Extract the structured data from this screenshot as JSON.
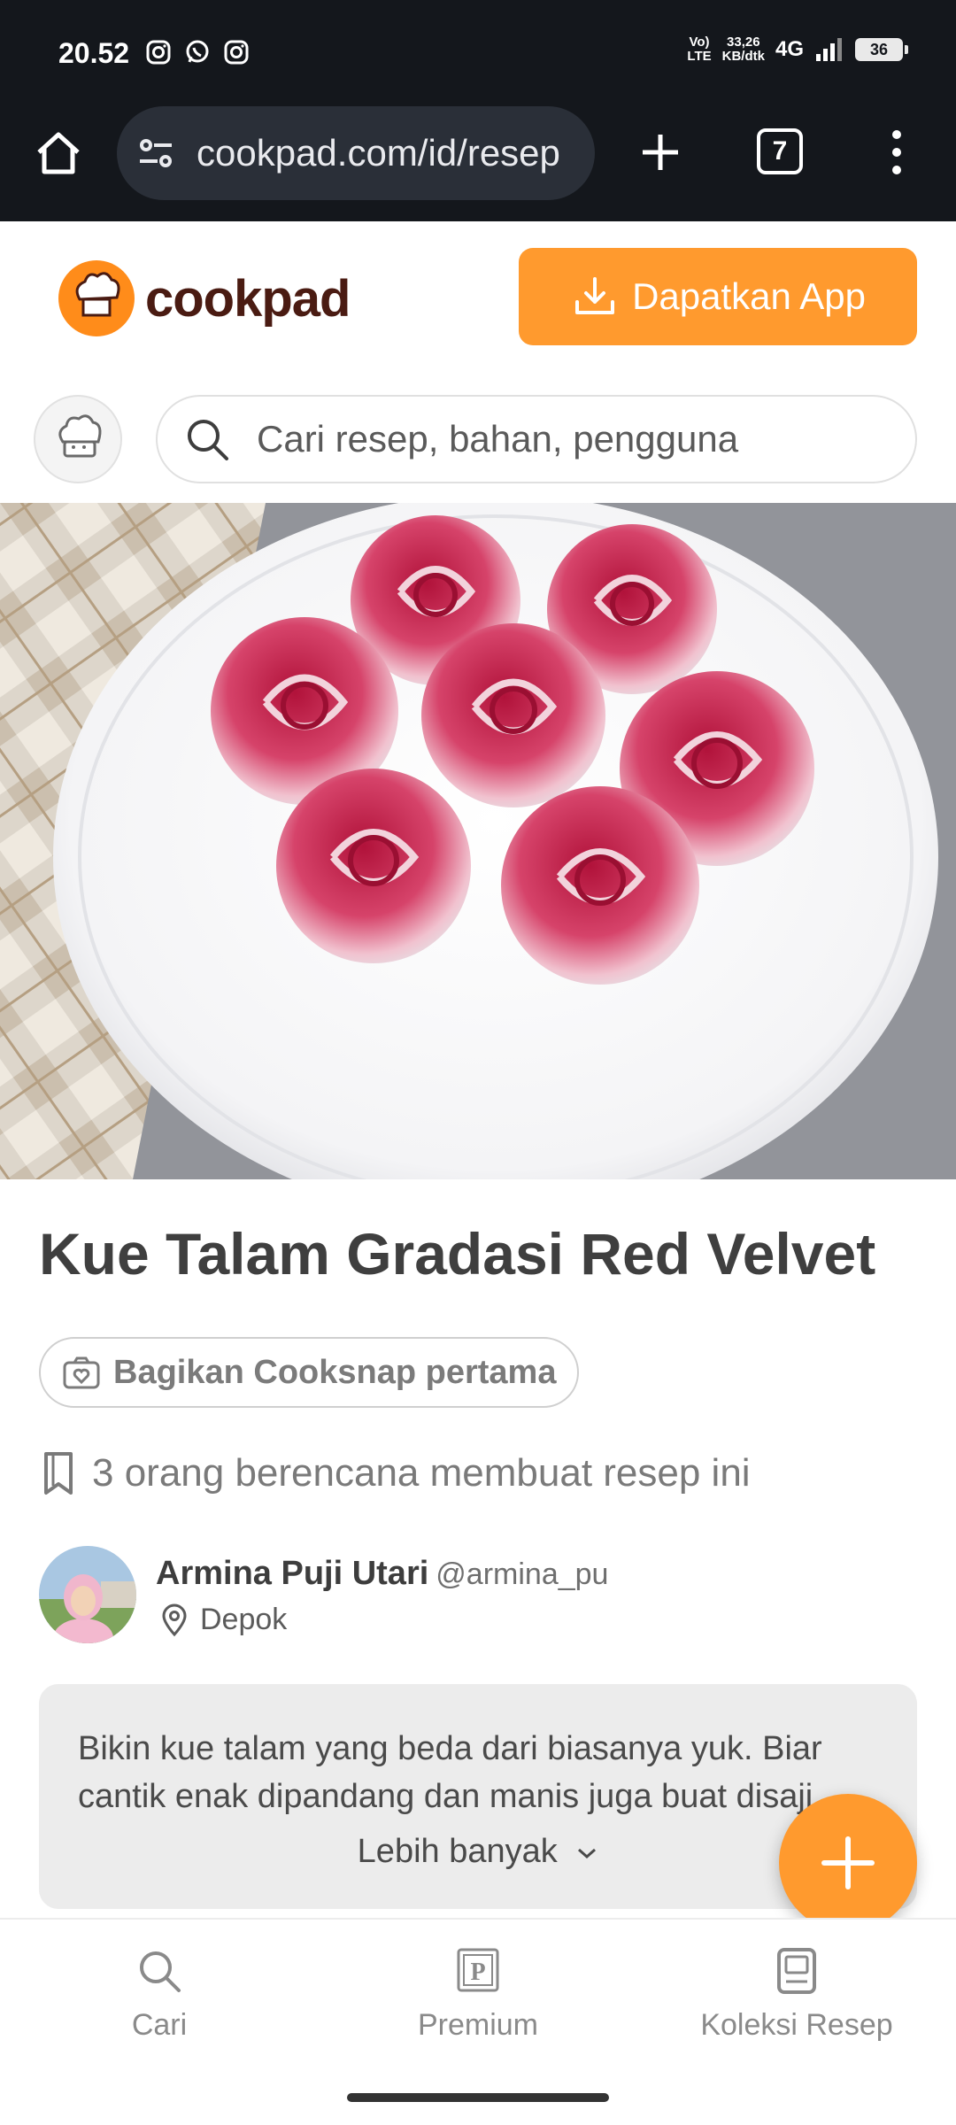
{
  "status_bar": {
    "time": "20.52",
    "network_speed": "33,26",
    "network_speed_unit": "KB/dtk",
    "volte": "VoLTE",
    "network_type": "4G",
    "battery": "36",
    "notification_icons": [
      "instagram-icon",
      "whatsapp-icon",
      "instagram-icon"
    ]
  },
  "browser": {
    "url": "cookpad.com/id/resep",
    "tab_count": "7"
  },
  "header": {
    "logo_text": "cookpad",
    "app_button": "Dapatkan App",
    "search_placeholder": "Cari resep, bahan, pengguna",
    "brand_color": "#ff9a2e"
  },
  "recipe": {
    "title": "Kue Talam Gradasi Red Velvet",
    "cooksnap_button": "Bagikan Cooksnap pertama",
    "plans_text": "3 orang berencana membuat resep ini",
    "author": {
      "name": "Armina Puji Utari",
      "handle": "@armina_pu",
      "location": "Depok"
    },
    "description": "Bikin kue talam yang beda dari biasanya yuk. Biar cantik enak dipandang dan manis juga buat disaji",
    "more_label": "Lebih banyak"
  },
  "bottom_nav": {
    "items": [
      {
        "label": "Cari",
        "icon": "search-icon"
      },
      {
        "label": "Premium",
        "icon": "premium-icon"
      },
      {
        "label": "Koleksi Resep",
        "icon": "collection-icon"
      }
    ]
  }
}
